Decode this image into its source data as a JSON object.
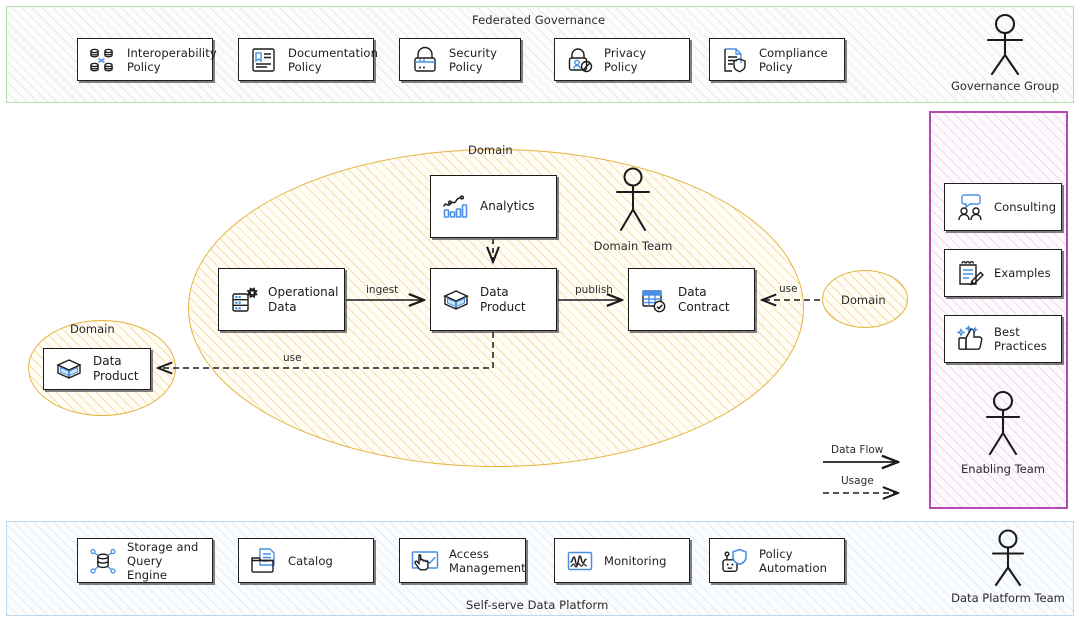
{
  "governance": {
    "band_label": "Federated Governance",
    "actor": "Governance Group",
    "items": [
      {
        "label": "Interoperability\nPolicy",
        "icon": "databases-link-icon"
      },
      {
        "label": "Documentation\nPolicy",
        "icon": "document-lines-icon"
      },
      {
        "label": "Security\nPolicy",
        "icon": "padlock-icon"
      },
      {
        "label": "Privacy\nPolicy",
        "icon": "privacy-lock-person-icon"
      },
      {
        "label": "Compliance\nPolicy",
        "icon": "document-shield-icon"
      }
    ]
  },
  "domain": {
    "main_label": "Domain",
    "actor": "Domain Team",
    "nodes": [
      {
        "label": "Analytics",
        "icon": "analytics-chart-icon"
      },
      {
        "label": "Operational\nData",
        "icon": "database-gear-icon"
      },
      {
        "label": "Data Product",
        "icon": "open-box-icon"
      },
      {
        "label": "Data\nContract",
        "icon": "table-check-icon"
      }
    ],
    "edges": [
      {
        "label": "ingest",
        "style": "solid"
      },
      {
        "label": "publish",
        "style": "solid"
      },
      {
        "label": "use",
        "style": "dashed"
      },
      {
        "label": "use",
        "style": "dashed"
      }
    ],
    "left_domain": {
      "label": "Domain",
      "node": {
        "label": "Data\nProduct",
        "icon": "open-box-icon"
      }
    },
    "right_domain": {
      "label": "Domain"
    }
  },
  "enabling": {
    "actor": "Enabling Team",
    "items": [
      {
        "label": "Consulting",
        "icon": "people-speech-icon"
      },
      {
        "label": "Examples",
        "icon": "clipboard-pencil-icon"
      },
      {
        "label": "Best\nPractices",
        "icon": "thumbs-up-sparkle-icon"
      }
    ]
  },
  "platform": {
    "band_label": "Self-serve Data Platform",
    "actor": "Data Platform Team",
    "items": [
      {
        "label": "Storage and\nQuery Engine",
        "icon": "database-network-icon"
      },
      {
        "label": "Catalog",
        "icon": "folder-document-icon"
      },
      {
        "label": "Access\nManagement",
        "icon": "hand-check-icon"
      },
      {
        "label": "Monitoring",
        "icon": "waveform-monitor-icon"
      },
      {
        "label": "Policy\nAutomation",
        "icon": "robot-shield-icon"
      }
    ]
  },
  "legend": {
    "data_flow": "Data Flow",
    "usage": "Usage"
  },
  "colors": {
    "governance_border": "#b9d8b4",
    "platform_border": "#bcd7ee",
    "enabling_border": "#b54ab5",
    "domain_border": "#e3b33c",
    "accent_blue": "#4a90e2",
    "ink": "#1b1b1b"
  }
}
